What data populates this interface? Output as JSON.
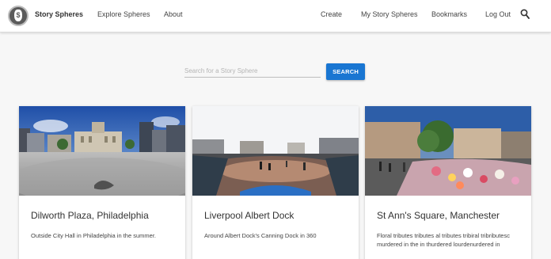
{
  "navbar": {
    "brand": "Story Spheres",
    "logo_glyph": "$",
    "links": [
      "Explore Spheres",
      "About"
    ],
    "right_links": [
      "Create",
      "My Story Spheres",
      "Bookmarks",
      "Log Out"
    ],
    "search_icon": "magnifier-icon"
  },
  "search": {
    "placeholder": "Search for a Story Sphere",
    "value": "",
    "button_label": "SEARCH",
    "button_color": "#1976d2"
  },
  "cards": [
    {
      "title": "Dilworth Plaza, Philadelphia",
      "description": "Outside City Hall in Philadelphia in the summer."
    },
    {
      "title": "Liverpool Albert Dock",
      "description": "Around Albert Dock's Canning Dock in 360"
    },
    {
      "title": "St Ann's Square, Manchester",
      "description": "Floral tributes tributes al tributes tribiral tribributesc murdered in the in thurdered lourdenurdered in"
    }
  ]
}
